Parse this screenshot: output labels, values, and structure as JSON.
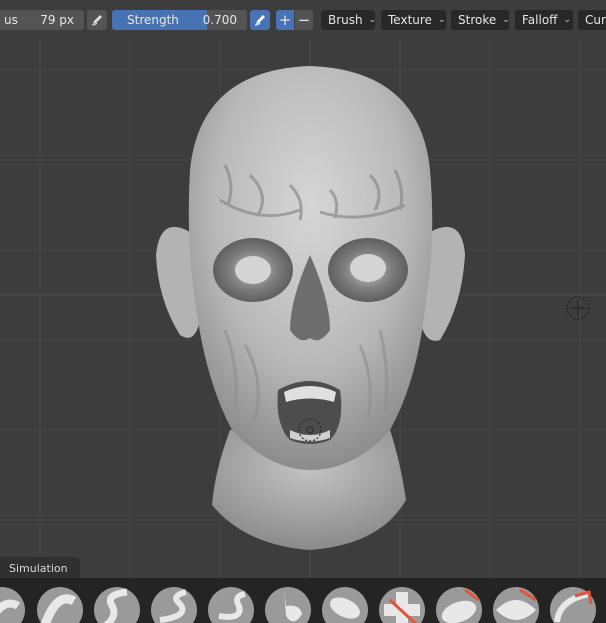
{
  "header": {
    "radius": {
      "label": "us",
      "value": "79 px"
    },
    "strength": {
      "label": "Strength",
      "value": "0.700",
      "level": 0.7
    },
    "dropdowns": [
      {
        "label": "Brush"
      },
      {
        "label": "Texture"
      },
      {
        "label": "Stroke"
      },
      {
        "label": "Falloff"
      },
      {
        "label": "Cur"
      }
    ]
  },
  "tabs": {
    "simulation": "Simulation"
  },
  "colors": {
    "accent": "#4772b3",
    "brush_accent": "#e0553c"
  },
  "icons": [
    "pen-pressure-icon",
    "plus-icon",
    "minus-icon",
    "chevron-down-icon",
    "brush-cursor-icon",
    "3d-cursor-icon"
  ]
}
